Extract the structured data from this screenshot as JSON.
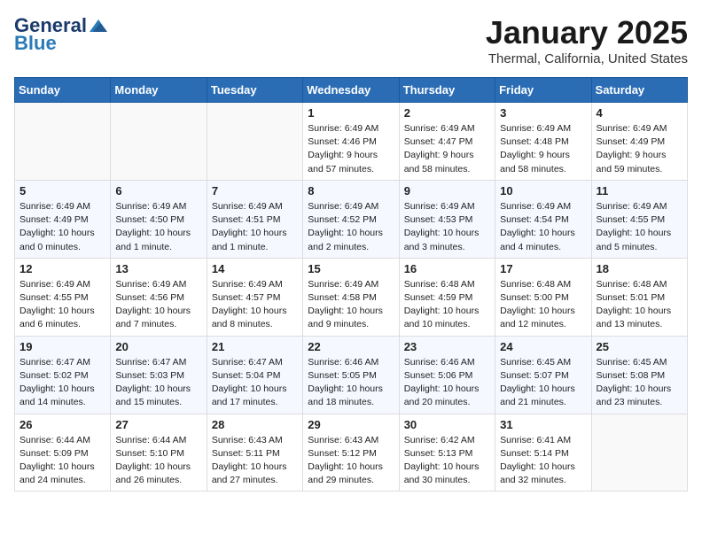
{
  "header": {
    "logo_general": "General",
    "logo_blue": "Blue",
    "month_title": "January 2025",
    "location": "Thermal, California, United States"
  },
  "weekdays": [
    "Sunday",
    "Monday",
    "Tuesday",
    "Wednesday",
    "Thursday",
    "Friday",
    "Saturday"
  ],
  "weeks": [
    [
      {
        "day": "",
        "sunrise": "",
        "sunset": "",
        "daylight": ""
      },
      {
        "day": "",
        "sunrise": "",
        "sunset": "",
        "daylight": ""
      },
      {
        "day": "",
        "sunrise": "",
        "sunset": "",
        "daylight": ""
      },
      {
        "day": "1",
        "sunrise": "Sunrise: 6:49 AM",
        "sunset": "Sunset: 4:46 PM",
        "daylight": "Daylight: 9 hours and 57 minutes."
      },
      {
        "day": "2",
        "sunrise": "Sunrise: 6:49 AM",
        "sunset": "Sunset: 4:47 PM",
        "daylight": "Daylight: 9 hours and 58 minutes."
      },
      {
        "day": "3",
        "sunrise": "Sunrise: 6:49 AM",
        "sunset": "Sunset: 4:48 PM",
        "daylight": "Daylight: 9 hours and 58 minutes."
      },
      {
        "day": "4",
        "sunrise": "Sunrise: 6:49 AM",
        "sunset": "Sunset: 4:49 PM",
        "daylight": "Daylight: 9 hours and 59 minutes."
      }
    ],
    [
      {
        "day": "5",
        "sunrise": "Sunrise: 6:49 AM",
        "sunset": "Sunset: 4:49 PM",
        "daylight": "Daylight: 10 hours and 0 minutes."
      },
      {
        "day": "6",
        "sunrise": "Sunrise: 6:49 AM",
        "sunset": "Sunset: 4:50 PM",
        "daylight": "Daylight: 10 hours and 1 minute."
      },
      {
        "day": "7",
        "sunrise": "Sunrise: 6:49 AM",
        "sunset": "Sunset: 4:51 PM",
        "daylight": "Daylight: 10 hours and 1 minute."
      },
      {
        "day": "8",
        "sunrise": "Sunrise: 6:49 AM",
        "sunset": "Sunset: 4:52 PM",
        "daylight": "Daylight: 10 hours and 2 minutes."
      },
      {
        "day": "9",
        "sunrise": "Sunrise: 6:49 AM",
        "sunset": "Sunset: 4:53 PM",
        "daylight": "Daylight: 10 hours and 3 minutes."
      },
      {
        "day": "10",
        "sunrise": "Sunrise: 6:49 AM",
        "sunset": "Sunset: 4:54 PM",
        "daylight": "Daylight: 10 hours and 4 minutes."
      },
      {
        "day": "11",
        "sunrise": "Sunrise: 6:49 AM",
        "sunset": "Sunset: 4:55 PM",
        "daylight": "Daylight: 10 hours and 5 minutes."
      }
    ],
    [
      {
        "day": "12",
        "sunrise": "Sunrise: 6:49 AM",
        "sunset": "Sunset: 4:55 PM",
        "daylight": "Daylight: 10 hours and 6 minutes."
      },
      {
        "day": "13",
        "sunrise": "Sunrise: 6:49 AM",
        "sunset": "Sunset: 4:56 PM",
        "daylight": "Daylight: 10 hours and 7 minutes."
      },
      {
        "day": "14",
        "sunrise": "Sunrise: 6:49 AM",
        "sunset": "Sunset: 4:57 PM",
        "daylight": "Daylight: 10 hours and 8 minutes."
      },
      {
        "day": "15",
        "sunrise": "Sunrise: 6:49 AM",
        "sunset": "Sunset: 4:58 PM",
        "daylight": "Daylight: 10 hours and 9 minutes."
      },
      {
        "day": "16",
        "sunrise": "Sunrise: 6:48 AM",
        "sunset": "Sunset: 4:59 PM",
        "daylight": "Daylight: 10 hours and 10 minutes."
      },
      {
        "day": "17",
        "sunrise": "Sunrise: 6:48 AM",
        "sunset": "Sunset: 5:00 PM",
        "daylight": "Daylight: 10 hours and 12 minutes."
      },
      {
        "day": "18",
        "sunrise": "Sunrise: 6:48 AM",
        "sunset": "Sunset: 5:01 PM",
        "daylight": "Daylight: 10 hours and 13 minutes."
      }
    ],
    [
      {
        "day": "19",
        "sunrise": "Sunrise: 6:47 AM",
        "sunset": "Sunset: 5:02 PM",
        "daylight": "Daylight: 10 hours and 14 minutes."
      },
      {
        "day": "20",
        "sunrise": "Sunrise: 6:47 AM",
        "sunset": "Sunset: 5:03 PM",
        "daylight": "Daylight: 10 hours and 15 minutes."
      },
      {
        "day": "21",
        "sunrise": "Sunrise: 6:47 AM",
        "sunset": "Sunset: 5:04 PM",
        "daylight": "Daylight: 10 hours and 17 minutes."
      },
      {
        "day": "22",
        "sunrise": "Sunrise: 6:46 AM",
        "sunset": "Sunset: 5:05 PM",
        "daylight": "Daylight: 10 hours and 18 minutes."
      },
      {
        "day": "23",
        "sunrise": "Sunrise: 6:46 AM",
        "sunset": "Sunset: 5:06 PM",
        "daylight": "Daylight: 10 hours and 20 minutes."
      },
      {
        "day": "24",
        "sunrise": "Sunrise: 6:45 AM",
        "sunset": "Sunset: 5:07 PM",
        "daylight": "Daylight: 10 hours and 21 minutes."
      },
      {
        "day": "25",
        "sunrise": "Sunrise: 6:45 AM",
        "sunset": "Sunset: 5:08 PM",
        "daylight": "Daylight: 10 hours and 23 minutes."
      }
    ],
    [
      {
        "day": "26",
        "sunrise": "Sunrise: 6:44 AM",
        "sunset": "Sunset: 5:09 PM",
        "daylight": "Daylight: 10 hours and 24 minutes."
      },
      {
        "day": "27",
        "sunrise": "Sunrise: 6:44 AM",
        "sunset": "Sunset: 5:10 PM",
        "daylight": "Daylight: 10 hours and 26 minutes."
      },
      {
        "day": "28",
        "sunrise": "Sunrise: 6:43 AM",
        "sunset": "Sunset: 5:11 PM",
        "daylight": "Daylight: 10 hours and 27 minutes."
      },
      {
        "day": "29",
        "sunrise": "Sunrise: 6:43 AM",
        "sunset": "Sunset: 5:12 PM",
        "daylight": "Daylight: 10 hours and 29 minutes."
      },
      {
        "day": "30",
        "sunrise": "Sunrise: 6:42 AM",
        "sunset": "Sunset: 5:13 PM",
        "daylight": "Daylight: 10 hours and 30 minutes."
      },
      {
        "day": "31",
        "sunrise": "Sunrise: 6:41 AM",
        "sunset": "Sunset: 5:14 PM",
        "daylight": "Daylight: 10 hours and 32 minutes."
      },
      {
        "day": "",
        "sunrise": "",
        "sunset": "",
        "daylight": ""
      }
    ]
  ]
}
